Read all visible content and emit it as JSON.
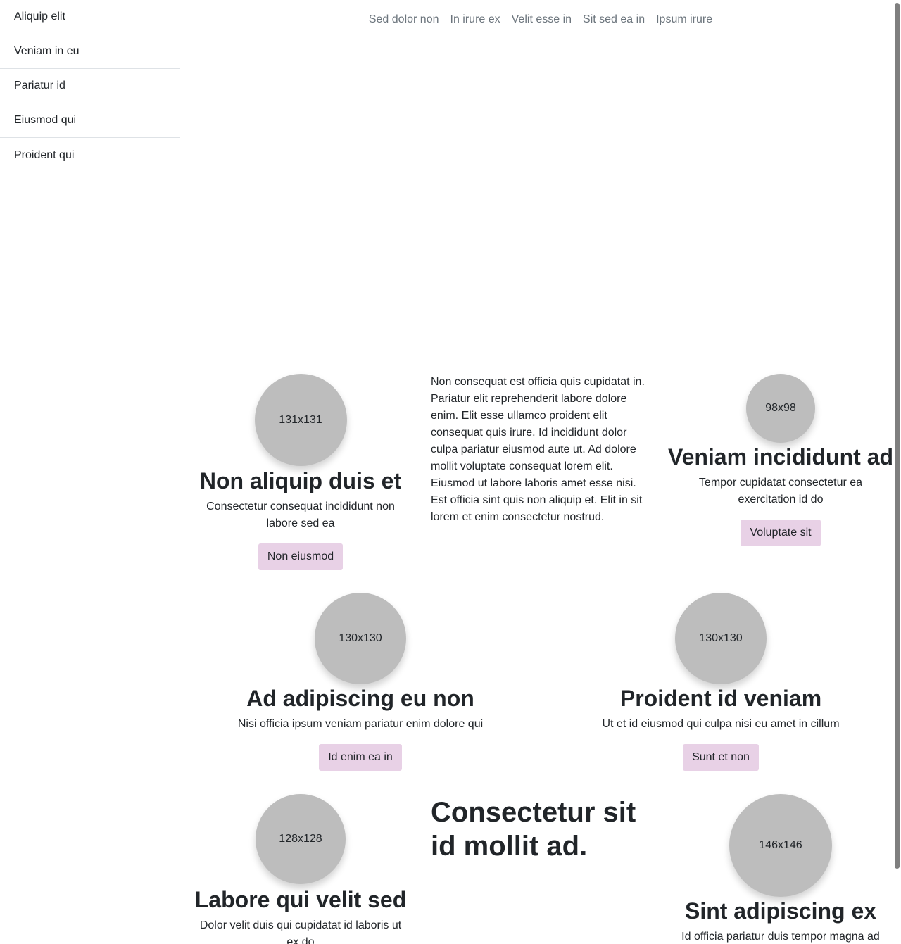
{
  "sidebar": {
    "items": [
      {
        "label": "Aliquip elit"
      },
      {
        "label": "Veniam in eu"
      },
      {
        "label": "Pariatur id"
      },
      {
        "label": "Eiusmod qui"
      },
      {
        "label": "Proident qui"
      }
    ]
  },
  "nav": {
    "links": [
      {
        "label": "Sed dolor non"
      },
      {
        "label": "In irure ex"
      },
      {
        "label": "Velit esse in"
      },
      {
        "label": "Sit sed ea in"
      },
      {
        "label": "Ipsum irure"
      }
    ]
  },
  "cards": {
    "c1": {
      "image": "131x131",
      "title": "Non aliquip duis et",
      "text": "Consectetur consequat incididunt non labore sed ea",
      "button": "Non eiusmod"
    },
    "c2": {
      "image": "98x98",
      "title": "Veniam incididunt ad",
      "text": "Tempor cupidatat consectetur ea exercitation id do",
      "button": "Voluptate sit"
    },
    "c3": {
      "image": "130x130",
      "title": "Ad adipiscing eu non",
      "text": "Nisi officia ipsum veniam pariatur enim dolore qui",
      "button": "Id enim ea in"
    },
    "c4": {
      "image": "130x130",
      "title": "Proident id veniam",
      "text": "Ut et id eiusmod qui culpa nisi eu amet in cillum",
      "button": "Sunt et non"
    },
    "c5": {
      "image": "128x128",
      "title": "Labore qui velit sed",
      "text": "Dolor velit duis qui cupidatat id laboris ut ex do"
    },
    "c6": {
      "image": "146x146",
      "title": "Sint adipiscing ex",
      "text": "Id officia pariatur duis tempor magna ad"
    }
  },
  "paragraph": "Non consequat est officia quis cupidatat in. Pariatur elit reprehenderit labore dolore enim. Elit esse ullamco proident elit consequat quis irure. Id incididunt dolor culpa pariatur eiusmod aute ut. Ad dolore mollit voluptate consequat lorem elit. Eiusmod ut labore laboris amet esse nisi. Est officia sint quis non aliquip et. Elit in sit lorem et enim consectetur nostrud.",
  "heading": "Consectetur sit id mollit ad."
}
